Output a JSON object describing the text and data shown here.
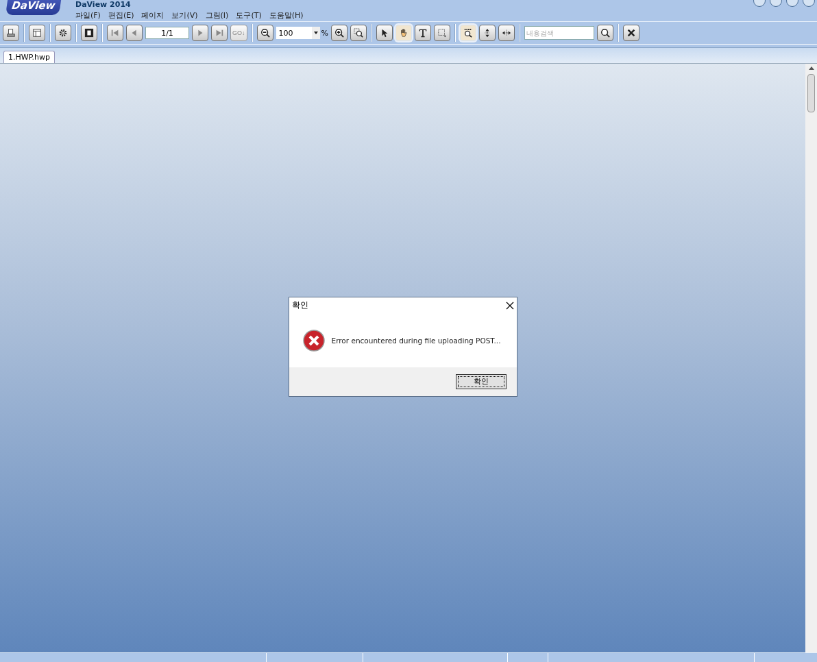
{
  "app": {
    "logo": "DaView",
    "title": "DaView 2014"
  },
  "menu": [
    "파일(F)",
    "편집(E)",
    "페이지",
    "보기(V)",
    "그림(I)",
    "도구(T)",
    "도움말(H)"
  ],
  "toolbar": [
    {
      "kind": "button",
      "selected": false
    },
    {
      "kind": "separator"
    },
    {
      "kind": "button",
      "selected": false
    },
    {
      "kind": "separator"
    },
    {
      "kind": "button",
      "selected": false
    },
    {
      "kind": "separator"
    },
    {
      "kind": "button",
      "selected": false
    },
    {
      "kind": "separator"
    },
    {
      "kind": "button",
      "selected": false
    },
    {
      "kind": "button",
      "selected": false
    },
    {
      "kind": "page_field",
      "value": "1/1"
    },
    {
      "kind": "button",
      "selected": false
    },
    {
      "kind": "button",
      "selected": false
    },
    {
      "kind": "text_button",
      "label": "GO↓"
    },
    {
      "kind": "separator"
    },
    {
      "kind": "button",
      "selected": false
    },
    {
      "kind": "zoom_select",
      "value": "100",
      "unit": "%"
    },
    {
      "kind": "button",
      "selected": false
    },
    {
      "kind": "button",
      "selected": false
    },
    {
      "kind": "separator"
    },
    {
      "kind": "button",
      "selected": false
    },
    {
      "kind": "button",
      "selected": true
    },
    {
      "kind": "button",
      "selected": false
    },
    {
      "kind": "button",
      "selected": false
    },
    {
      "kind": "separator"
    },
    {
      "kind": "button",
      "selected": true
    },
    {
      "kind": "button",
      "selected": false
    },
    {
      "kind": "button",
      "selected": false
    },
    {
      "kind": "separator"
    },
    {
      "kind": "search",
      "placeholder": "내용검색"
    },
    {
      "kind": "button",
      "selected": false
    },
    {
      "kind": "separator"
    },
    {
      "kind": "button",
      "selected": false
    }
  ],
  "tabs": [
    {
      "label": "1.HWP.hwp",
      "selected": true
    }
  ],
  "dialog": {
    "title": "확인",
    "message": "Error encountered during file uploading POST...",
    "button": "확인"
  }
}
